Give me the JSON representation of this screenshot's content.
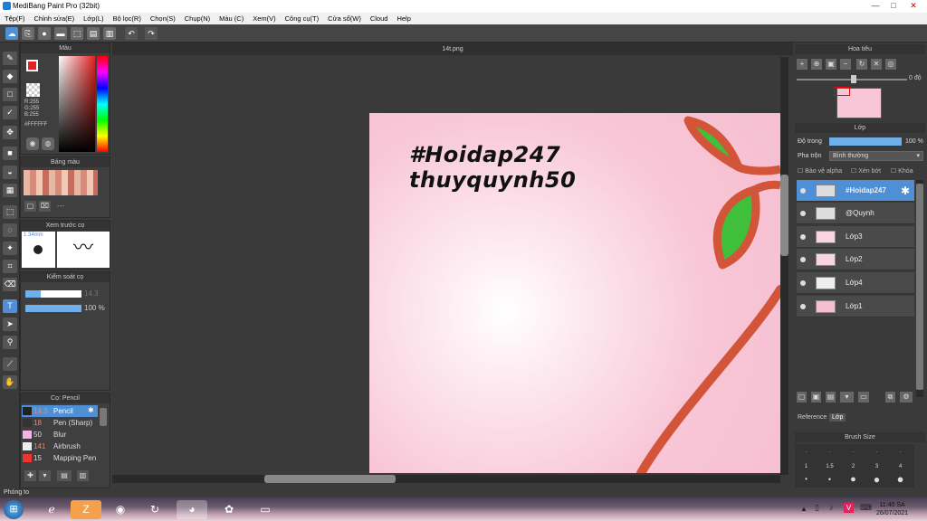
{
  "window": {
    "title": "MediBang Paint Pro (32bit)",
    "min": "—",
    "max": "□",
    "close": "✕"
  },
  "menu": [
    "Tệp(F)",
    "Chỉnh sửa(E)",
    "Lớp(L)",
    "Bộ lọc(R)",
    "Chọn(S)",
    "Chụp(N)",
    "Màu (C)",
    "Xem(V)",
    "Công cụ(T)",
    "Cửa sổ(W)",
    "Cloud",
    "Help"
  ],
  "colors": {
    "accent": "#4f8fd6",
    "primary_color": "#e32222",
    "canvas_pink": "#f6bfd2",
    "leaf_green": "#3fbf3a",
    "branch": "#d2553a"
  },
  "color_panel": {
    "title": "Màu",
    "r": "R:255",
    "g": "G:255",
    "b": "B:255",
    "hex": "#FFFFFF"
  },
  "palette": {
    "title": "Bảng màu",
    "extra": "---"
  },
  "brush_preview": {
    "title": "Xem trước cọ",
    "size": "1.34mm"
  },
  "brush_control": {
    "title": "Kiểm soát cọ",
    "size": "14.3",
    "opacity": "100 %"
  },
  "brush_list": {
    "title": "Cọ: Pencil",
    "items": [
      {
        "size": "14.3",
        "name": "Pencil",
        "selected": true
      },
      {
        "size": "18",
        "name": "Pen (Sharp)",
        "selected": false
      },
      {
        "size": "50",
        "name": "Blur",
        "selected": false
      },
      {
        "size": "141",
        "name": "Airbrush",
        "selected": false
      },
      {
        "size": "15",
        "name": "Mapping Pen",
        "selected": false
      }
    ]
  },
  "document": {
    "tab": "14t.png",
    "text_line1": "#Hoidap247",
    "text_line2": "thuyquynh50"
  },
  "navigator": {
    "title": "Hoa tiêu",
    "angle": "0 độ"
  },
  "layers_panel": {
    "title": "Lớp",
    "opacity_label": "Độ trong",
    "opacity_value": "100 %",
    "blend_label": "Pha trộn",
    "blend_value": "Bình thường",
    "protect_alpha": "Bảo vệ alpha",
    "clipping": "Xén bớt",
    "lock": "Khóa",
    "layers": [
      {
        "name": "#Hoidap247",
        "selected": true
      },
      {
        "name": "@Quynh",
        "selected": false
      },
      {
        "name": "Lớp3",
        "selected": false
      },
      {
        "name": "Lớp2",
        "selected": false
      },
      {
        "name": "Lớp4",
        "selected": false
      },
      {
        "name": "Lớp1",
        "selected": false
      }
    ],
    "tab_reference": "Reference",
    "tab_layer": "Lớp"
  },
  "brush_size_panel": {
    "title": "Brush Size",
    "labels": [
      "1",
      "1.5",
      "2",
      "3",
      "4"
    ]
  },
  "status": {
    "zoom_label": "Phóng to"
  },
  "taskbar": {
    "time": "11:40 SA",
    "date": "26/07/2021"
  }
}
